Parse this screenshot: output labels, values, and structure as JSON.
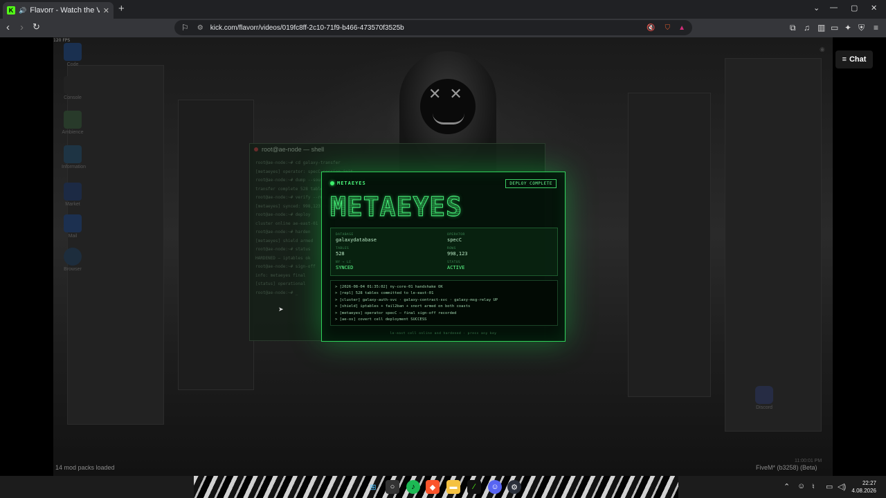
{
  "browser": {
    "tab_title": "Flavorr - Watch the VOD on Kick",
    "new_tab": "+",
    "url": "kick.com/flavorr/videos/019fc8ff-2c10-71f9-b466-473570f3525b",
    "window_controls": {
      "minimize": "—",
      "maximize": "▢",
      "close": "✕",
      "tab_list": "⌄"
    },
    "nav": {
      "back": "‹",
      "forward": "›",
      "reload": "↻"
    },
    "favicon_letter": "K"
  },
  "stream": {
    "fps": "120 FPS",
    "chat_button": "Chat",
    "mod_packs": "14 mod packs loaded",
    "fivem_label": "FiveM* (b3258) (Beta)",
    "ingame_clock": "11:00:01 PM",
    "desktop_icons": [
      "Code",
      "Console",
      "Ambience",
      "Information",
      "Market",
      "Mail",
      "Browser"
    ],
    "discord_label": "Discord",
    "shell": {
      "title": "root@ae-node — shell",
      "lines": [
        "root@ae-node:~# cd galaxy-transfer",
        "[metaeyes] operator: specC session init",
        "root@ae-node:~# dump --source galaxydatabase",
        "transfer complete  528 tables",
        "root@ae-node:~# verify --rows",
        "[metaeyes] synced: 998,123 rows",
        "root@ae-node:~# deploy",
        "cluster online  ae-east-01",
        "root@ae-node:~# harden",
        "[metaeyes] shield armed",
        "root@ae-node:~# status",
        "HARDENED — iptables ok",
        "root@ae-node:~# sign-off",
        "info: metaeyes final",
        "[status] operational",
        "root@ae-node:~# _"
      ]
    },
    "panel": {
      "brand": "METAEYES",
      "badge": "DEPLOY COMPLETE",
      "logo": "METAEYES",
      "fields": {
        "database_key": "DATABASE",
        "database_val": "galaxydatabase",
        "operator_key": "OPERATOR",
        "operator_val": "specC",
        "tables_key": "TABLES",
        "tables_val": "528",
        "rows_key": "ROWS",
        "rows_val": "998,123",
        "sync_key": "NY → LE",
        "sync_val": "SYNCED",
        "status_key": "STATUS",
        "status_val": "ACTIVE"
      },
      "log": [
        "> [2026-08-04 01:35:02] ny-core-01 handshake OK",
        "> [repl] 528 tables committed to le-east-01",
        "> [cluster] galaxy-auth-svc · galaxy-contract-svc · galaxy-msg-relay UP",
        "> [shield] iptables + fail2ban + snort armed on both coasts",
        "> [metaeyes] operator specC — final sign-off recorded",
        "> [ae-os] covert cell deployment SUCCESS"
      ],
      "footer": "le-east cell online and hardened · press any key"
    }
  },
  "taskbar": {
    "clock_time": "22:27",
    "clock_date": "4.08.2026",
    "apps": [
      "windows-start",
      "search",
      "spotify",
      "brave",
      "file-explorer",
      "terminal",
      "discord",
      "steam"
    ]
  },
  "colors": {
    "accent_green": "#46f07a",
    "kick_green": "#53fc18",
    "panel_border": "#2fd35a"
  }
}
